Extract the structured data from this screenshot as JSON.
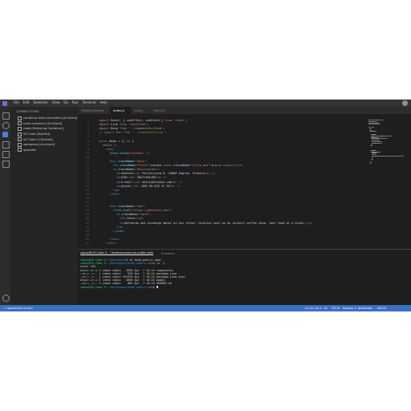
{
  "menu": [
    "File",
    "Edit",
    "Selection",
    "View",
    "Go",
    "Run",
    "Terminal",
    "Help"
  ],
  "sidebar": {
    "title": "CONNECTIONS",
    "items": [
      "container-from-vsb-editor [Archived]",
      "main-container [Archived]",
      "node [Restoring Container]",
      "VS Code [Started]",
      "VS Code 2 [Started]",
      "wordpress [Archived]",
      "aprnette"
    ]
  },
  "tabs": [
    "Getting Started",
    "index.js",
    "red.js",
    "rhtml.js"
  ],
  "code": [
    {
      "n": "1",
      "seg": [
        [
          "k",
          "import"
        ],
        [
          "w",
          " React, { useEffect, useState } "
        ],
        [
          "k",
          "from"
        ],
        [
          "s",
          " 'react'"
        ],
        [
          "w",
          ";"
        ]
      ]
    },
    {
      "n": "2",
      "seg": [
        [
          "k",
          "import"
        ],
        [
          "w",
          " Link "
        ],
        [
          "k",
          "from"
        ],
        [
          "s",
          " 'next/link'"
        ],
        [
          "w",
          ";"
        ]
      ]
    },
    {
      "n": "3",
      "seg": [
        [
          "k",
          "import"
        ],
        [
          "w",
          " Head "
        ],
        [
          "k",
          "from"
        ],
        [
          "s",
          " '../components/head'"
        ],
        [
          "w",
          ";"
        ]
      ]
    },
    {
      "n": "4",
      "seg": [
        [
          "c",
          "// import Nav from '../components/nav';"
        ]
      ]
    },
    {
      "n": "5",
      "seg": []
    },
    {
      "n": "6",
      "seg": [
        [
          "kb",
          "const"
        ],
        [
          "f",
          " Home"
        ],
        [
          "w",
          " = () => {"
        ]
      ]
    },
    {
      "n": "7",
      "seg": [
        [
          "k",
          "  return"
        ],
        [
          "w",
          " ("
        ]
      ]
    },
    {
      "n": "8",
      "seg": [
        [
          "p",
          "    <"
        ],
        [
          "kb",
          "div"
        ],
        [
          "p",
          ">"
        ]
      ]
    },
    {
      "n": "9",
      "seg": [
        [
          "p",
          "      <"
        ],
        [
          "t",
          "Head"
        ],
        [
          "a",
          " title"
        ],
        [
          "w",
          "="
        ],
        [
          "s",
          "\"Lenkea\""
        ],
        [
          "p",
          " />"
        ]
      ]
    },
    {
      "n": "10",
      "seg": []
    },
    {
      "n": "11",
      "seg": [
        [
          "p",
          "      <"
        ],
        [
          "kb",
          "div"
        ],
        [
          "a",
          " className"
        ],
        [
          "w",
          "="
        ],
        [
          "s",
          "\"hero\""
        ],
        [
          "p",
          ">"
        ]
      ]
    },
    {
      "n": "12",
      "seg": [
        [
          "p",
          "        <"
        ],
        [
          "kb",
          "h1"
        ],
        [
          "a",
          " className"
        ],
        [
          "w",
          "="
        ],
        [
          "s",
          "\"title\""
        ],
        [
          "p",
          ">"
        ],
        [
          "w",
          "Lenkea "
        ],
        [
          "p",
          "<"
        ],
        [
          "kb",
          "span"
        ],
        [
          "a",
          " className"
        ],
        [
          "w",
          "="
        ],
        [
          "s",
          "\"title_dot\""
        ],
        [
          "p",
          ">"
        ],
        [
          "w",
          "d.o.o."
        ],
        [
          "p",
          "</"
        ],
        [
          "kb",
          "span"
        ],
        [
          "p",
          "></"
        ],
        [
          "kb",
          "h1"
        ],
        [
          "p",
          ">"
        ]
      ]
    },
    {
      "n": "13",
      "seg": [
        [
          "p",
          "        <"
        ],
        [
          "kb",
          "p"
        ],
        [
          "a",
          " className"
        ],
        [
          "w",
          "="
        ],
        [
          "s",
          "\"description\""
        ],
        [
          "p",
          ">"
        ]
      ]
    },
    {
      "n": "14",
      "seg": [
        [
          "p",
          "          <"
        ],
        [
          "kb",
          "p"
        ],
        [
          "p",
          ">"
        ],
        [
          "w",
          "address"
        ],
        [
          "p",
          "</"
        ],
        [
          "kb",
          "b"
        ],
        [
          "p",
          ">"
        ],
        [
          "w",
          " Petrolijeva 6, 10000 Zagreb, Croatia"
        ],
        [
          "p",
          "<"
        ],
        [
          "kb",
          "br"
        ],
        [
          "p",
          " />"
        ]
      ]
    },
    {
      "n": "15",
      "seg": [
        [
          "p",
          "          <"
        ],
        [
          "kb",
          "p"
        ],
        [
          "p",
          ">"
        ],
        [
          "w",
          "OIB:"
        ],
        [
          "p",
          "</"
        ],
        [
          "kb",
          "b"
        ],
        [
          "p",
          ">"
        ],
        [
          "w",
          " 38271401409"
        ],
        [
          "p",
          "<"
        ],
        [
          "kb",
          "br"
        ],
        [
          "p",
          " />"
        ]
      ]
    },
    {
      "n": "16",
      "seg": [
        [
          "p",
          "          <"
        ],
        [
          "kb",
          "p"
        ],
        [
          "p",
          ">"
        ],
        [
          "w",
          "e-mail:"
        ],
        [
          "p",
          "</"
        ],
        [
          "kb",
          "b"
        ],
        [
          "p",
          ">"
        ],
        [
          "w",
          " matija@lenkea.com"
        ],
        [
          "p",
          "<"
        ],
        [
          "kb",
          "br"
        ],
        [
          "p",
          " />"
        ]
      ]
    },
    {
      "n": "17",
      "seg": [
        [
          "p",
          "          <"
        ],
        [
          "kb",
          "p"
        ],
        [
          "p",
          ">"
        ],
        [
          "w",
          "phone:"
        ],
        [
          "p",
          "</"
        ],
        [
          "kb",
          "b"
        ],
        [
          "p",
          ">"
        ],
        [
          "w",
          " +385 99 833 31 36"
        ],
        [
          "p",
          "<"
        ],
        [
          "kb",
          "br"
        ],
        [
          "p",
          " />"
        ]
      ]
    },
    {
      "n": "18",
      "seg": [
        [
          "p",
          "        </"
        ],
        [
          "kb",
          "p"
        ],
        [
          "p",
          ">"
        ]
      ]
    },
    {
      "n": "19",
      "seg": [
        [
          "p",
          "      </"
        ],
        [
          "kb",
          "div"
        ],
        [
          "p",
          ">"
        ]
      ]
    },
    {
      "n": "20",
      "seg": []
    },
    {
      "n": "21",
      "seg": []
    },
    {
      "n": "22",
      "seg": [
        [
          "p",
          "      <"
        ],
        [
          "kb",
          "div"
        ],
        [
          "a",
          " className"
        ],
        [
          "w",
          "="
        ],
        [
          "s",
          "\"row\""
        ],
        [
          "p",
          ">"
        ]
      ]
    },
    {
      "n": "23",
      "seg": [
        [
          "p",
          "        <"
        ],
        [
          "t",
          "Link"
        ],
        [
          "a",
          " href"
        ],
        [
          "w",
          "="
        ],
        [
          "s",
          "\"https://getcetus.com\""
        ],
        [
          "p",
          ">"
        ]
      ]
    },
    {
      "n": "24",
      "seg": [
        [
          "p",
          "          <"
        ],
        [
          "kb",
          "a"
        ],
        [
          "a",
          " className"
        ],
        [
          "w",
          "="
        ],
        [
          "s",
          "\"card\""
        ],
        [
          "p",
          ">"
        ]
      ]
    },
    {
      "n": "25",
      "seg": [
        [
          "p",
          "            <"
        ],
        [
          "kb",
          "h3"
        ],
        [
          "p",
          ">"
        ],
        [
          "w",
          "Cetus"
        ],
        [
          "p",
          "</"
        ],
        [
          "kb",
          "h3"
        ],
        [
          "p",
          ">"
        ]
      ]
    },
    {
      "n": "26",
      "seg": [
        [
          "p",
          "            <"
        ],
        [
          "kb",
          "p"
        ],
        [
          "p",
          ">"
        ],
        [
          "w",
          "Withdraw and exchange money at any retail location such as an airport coffee shop, fast food or a kiosk."
        ],
        [
          "p",
          "</"
        ],
        [
          "kb",
          "p"
        ],
        [
          "p",
          ">"
        ]
      ]
    },
    {
      "n": "27",
      "seg": [
        [
          "p",
          "          </"
        ],
        [
          "kb",
          "a"
        ],
        [
          "p",
          ">"
        ]
      ]
    },
    {
      "n": "28",
      "seg": [
        [
          "p",
          "        </"
        ],
        [
          "t",
          "Link"
        ],
        [
          "p",
          ">"
        ]
      ]
    },
    {
      "n": "29",
      "seg": []
    },
    {
      "n": "30",
      "seg": [
        [
          "p",
          "      </"
        ],
        [
          "kb",
          "div"
        ],
        [
          "p",
          ">"
        ]
      ]
    },
    {
      "n": "31",
      "seg": [
        [
          "p",
          "    </"
        ],
        [
          "kb",
          "div"
        ],
        [
          "p",
          ">"
        ]
      ]
    }
  ],
  "panel": {
    "tab_terminal": "cabox@VS-Code-2: ~/workspace/acme-public-web",
    "tab_problems": "Problems",
    "lines": [
      {
        "user": "cabox@VS-Code-2",
        "path": "~/workspace",
        "cmd": "$ cd acme-public-web/"
      },
      {
        "user": "cabox@VS-Code-2",
        "path": "~/workspace/acme-public-web",
        "cmd": "$ ls -l"
      },
      {
        "text": "total 204"
      },
      {
        "text": "drwxr-xr-x 2 cabox cabox   4096 Apr  7 10:24 components"
      },
      {
        "text": "-rw-r--r-- 1 cabox cabox    539 Apr  7 10:24 package.json"
      },
      {
        "text": "-rw-r--r-- 1 cabox cabox 191976 Apr  7 10:24 package-lock.json"
      },
      {
        "text": "drwxr-xr-x 2 cabox cabox   4096 Apr  7 10:24 pages"
      },
      {
        "text": "-rw-r--r-- 1 cabox cabox    882 Apr  7 10:24 README.md"
      },
      {
        "user": "cabox@VS-Code-2",
        "path": "~/workspace/acme-public-web",
        "cmd": "$ ",
        "cursor": true
      }
    ]
  },
  "status": {
    "remote": "↑ goorm/ide-cursor*",
    "position": "Ln 16, Col 1",
    "spaces": "LF",
    "encoding": "UTF-8",
    "indent": "Spaces: 2",
    "lang": "JavaScript",
    "ext": "ESLint"
  },
  "colors": {
    "statusbar": "#3771c7",
    "editor_bg": "#1e1e1e",
    "sidebar_bg": "#252526"
  }
}
